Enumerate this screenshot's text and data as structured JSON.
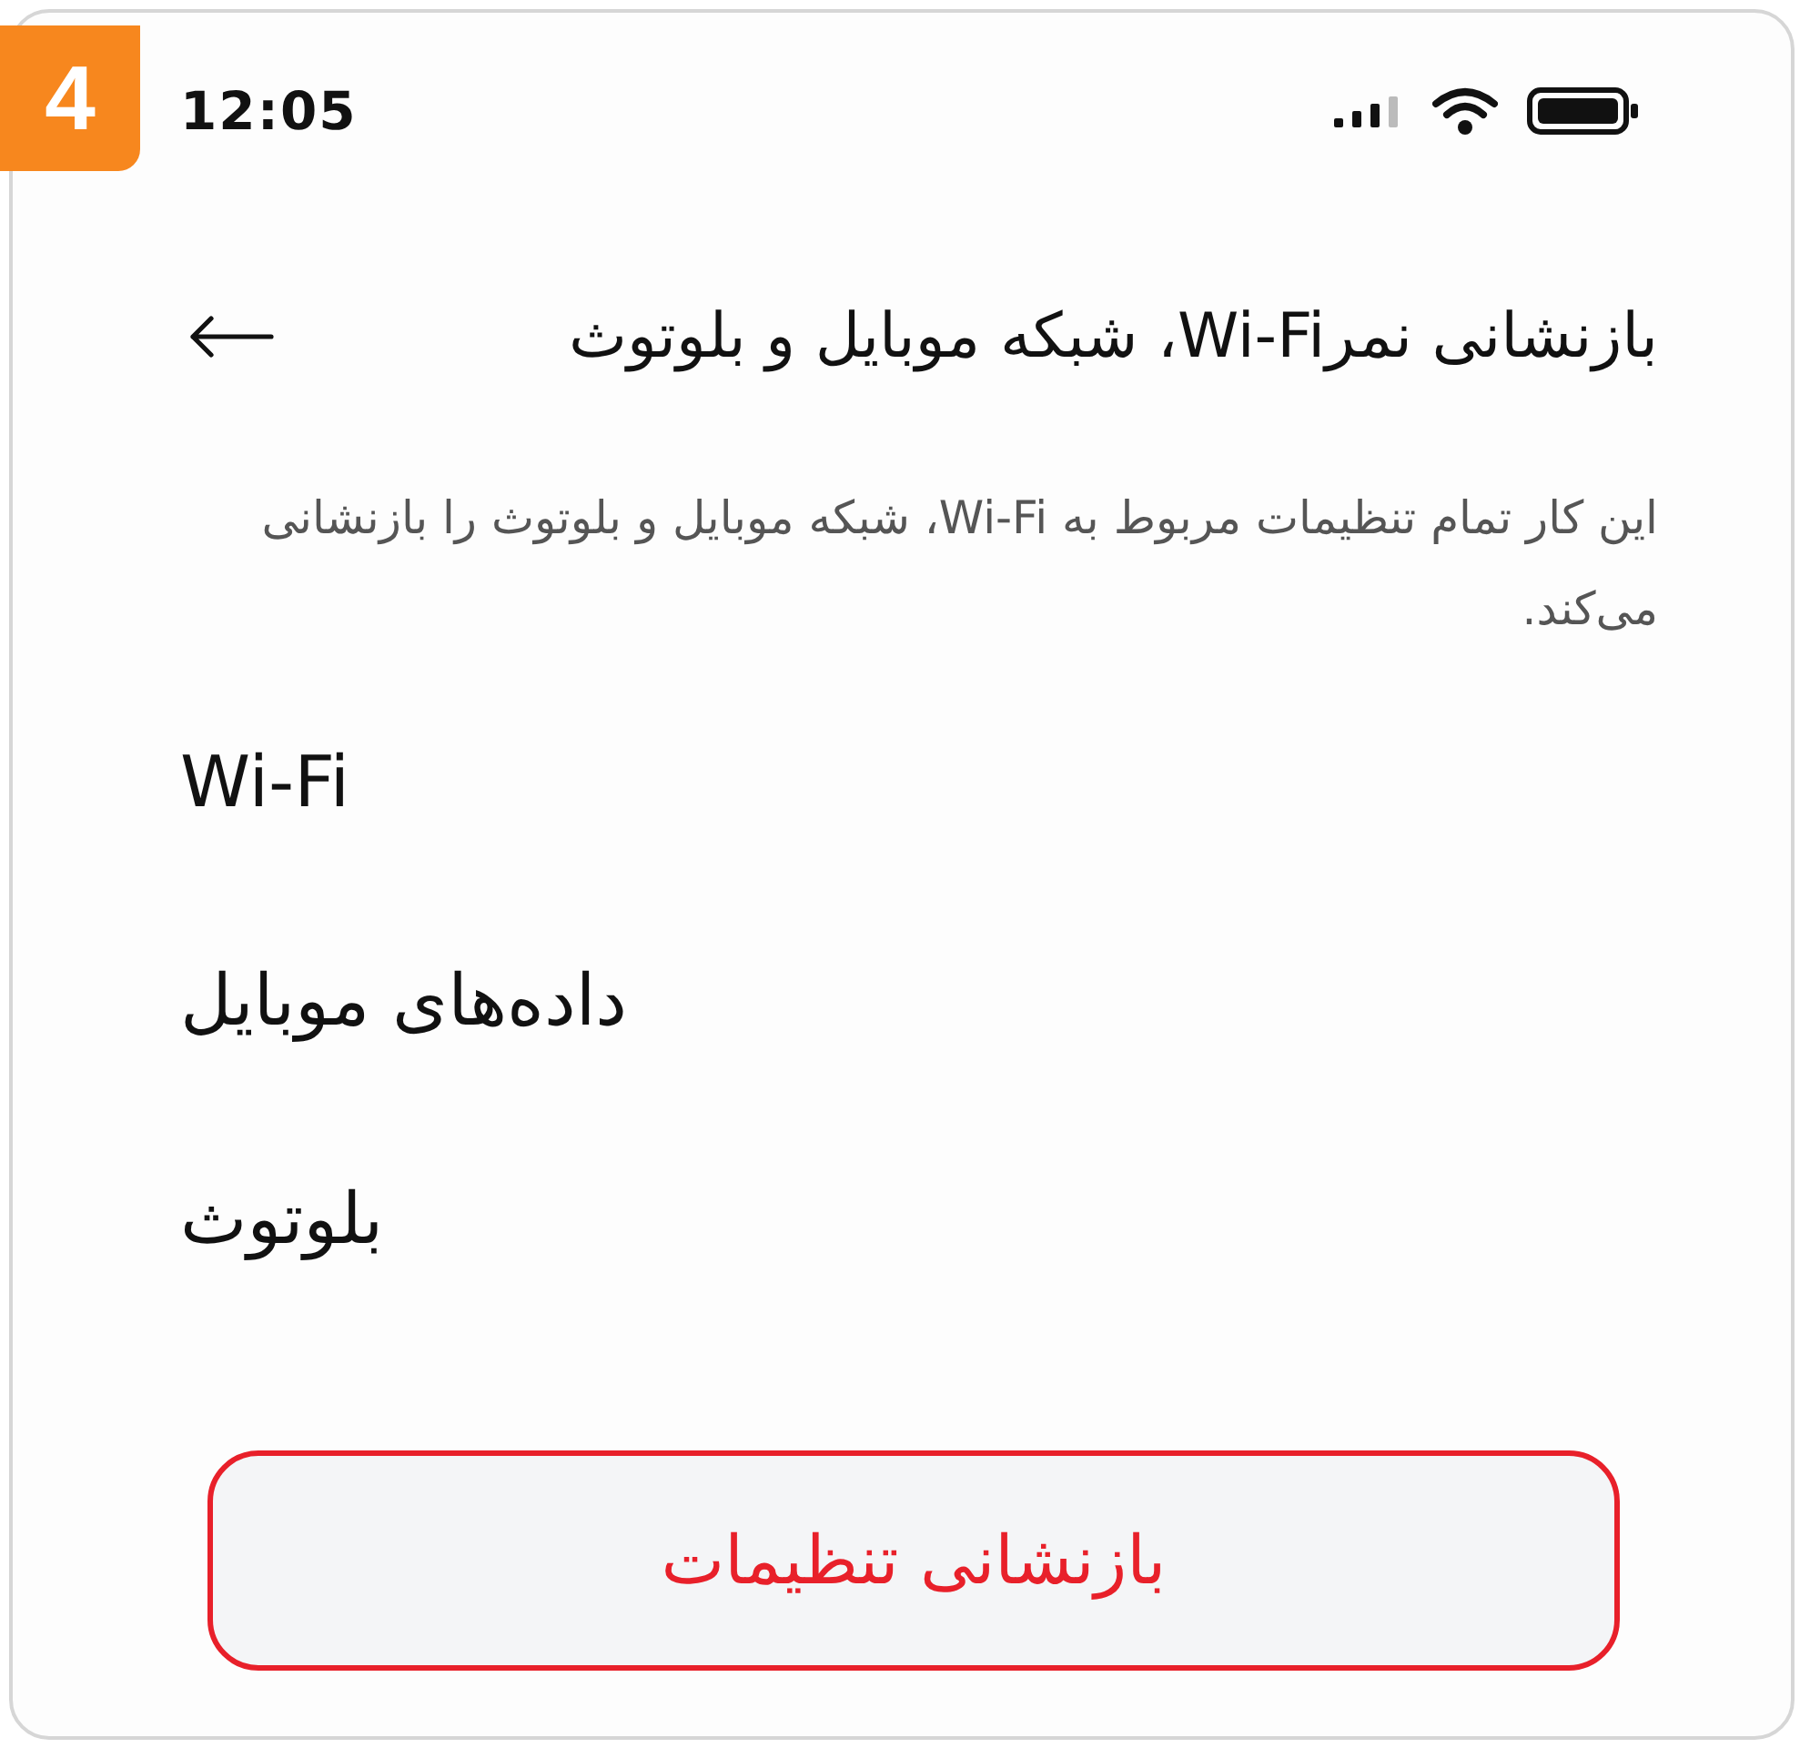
{
  "step_badge": "4",
  "status_bar": {
    "time": "12:05"
  },
  "header": {
    "title": "بازنشانی نمرWi-Fi، شبکه موبایل و بلوتوث"
  },
  "description": "این کار تمام تنظیمات مربوط به Wi-Fi، شبکه موبایل و بلوتوث را بازنشانی می‌کند.",
  "items": [
    {
      "label": "Wi-Fi"
    },
    {
      "label": "داده‌های موبایل"
    },
    {
      "label": "بلوتوث"
    }
  ],
  "reset_button": {
    "label": "بازنشانی تنظیمات"
  }
}
